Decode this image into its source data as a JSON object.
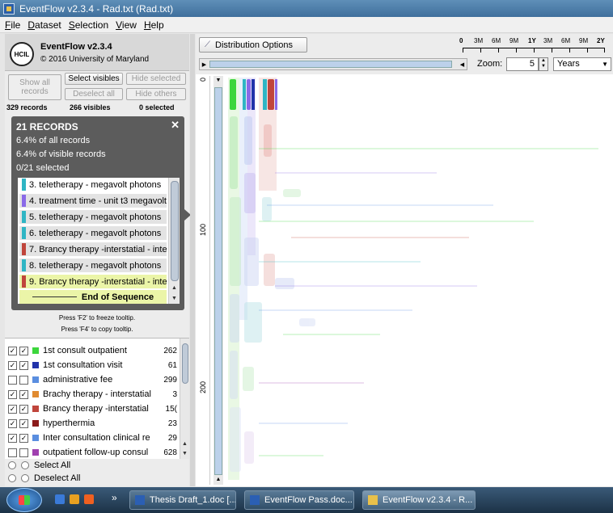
{
  "window": {
    "title": "EventFlow v2.3.4 - Rad.txt (Rad.txt)"
  },
  "menu": [
    "File",
    "Dataset",
    "Selection",
    "View",
    "Help"
  ],
  "brand": {
    "logo": "HCIL",
    "name": "EventFlow v2.3.4",
    "copyright": "© 2016 University of Maryland"
  },
  "buttons": {
    "show_all": "Show all records",
    "select_visibles": "Select visibles",
    "hide_selected": "Hide selected",
    "deselect_all": "Deselect all",
    "hide_others": "Hide others"
  },
  "counts": {
    "records": "329 records",
    "visibles": "266 visibles",
    "selected": "0 selected"
  },
  "tooltip": {
    "heading": "21 RECORDS",
    "line1": "6.4% of all records",
    "line2": "6.4% of visible records",
    "line3": "0/21 selected",
    "close": "✕",
    "items": [
      {
        "label": "3. teletherapy - megavolt photons",
        "color": "#2fb5c4"
      },
      {
        "label": "4. treatment time - unit t3 megavolt",
        "color": "#8a6ae8"
      },
      {
        "label": "5. teletherapy - megavolt photons",
        "color": "#2fb5c4"
      },
      {
        "label": "6. teletherapy - megavolt photons",
        "color": "#2fb5c4"
      },
      {
        "label": "7. Brancy therapy -interstatial - inte",
        "color": "#c0453c"
      },
      {
        "label": "8. teletherapy - megavolt photons",
        "color": "#2fb5c4"
      },
      {
        "label": "9. Brancy therapy -interstatial - inte",
        "color": "#c0453c"
      }
    ],
    "end": "End of Sequence"
  },
  "hints": {
    "freeze": "Press 'F2' to freeze tooltip.",
    "copy": "Press 'F4' to copy tooltip."
  },
  "legend": [
    {
      "name": "1st consult outpatient",
      "count": "262",
      "color": "#3dd63d",
      "checked": true
    },
    {
      "name": "1st consultation visit",
      "count": "61",
      "color": "#2233aa",
      "checked": true
    },
    {
      "name": "administrative fee",
      "count": "299",
      "color": "#5a8ee0",
      "checked": false
    },
    {
      "name": "Brachy therapy - interstatial",
      "count": "3",
      "color": "#e08a30",
      "checked": true
    },
    {
      "name": "Brancy therapy -interstatial",
      "count": "15(",
      "color": "#c0453c",
      "checked": true
    },
    {
      "name": "hyperthermia",
      "count": "23",
      "color": "#8b1a1a",
      "checked": true
    },
    {
      "name": "Inter consultation clinical re",
      "count": "29",
      "color": "#5a8ee0",
      "checked": true
    },
    {
      "name": "outpatient follow-up consul",
      "count": "628",
      "color": "#a040b0",
      "checked": false
    }
  ],
  "select": {
    "all": "Select All",
    "none": "Deselect All"
  },
  "toolbar": {
    "distribution": "Distribution Options",
    "ruler": [
      "0",
      "3M",
      "6M",
      "9M",
      "1Y",
      "3M",
      "6M",
      "9M",
      "2Y"
    ],
    "zoom_label": "Zoom:",
    "zoom_value": "5",
    "unit": "Years"
  },
  "y_ruler": [
    "0",
    "100",
    "200"
  ],
  "taskbar": [
    {
      "label": "Thesis Draft_1.doc [...",
      "kind": "word"
    },
    {
      "label": "EventFlow Pass.doc...",
      "kind": "word"
    },
    {
      "label": "EventFlow v2.3.4 - R...",
      "kind": "app"
    }
  ],
  "colors": {
    "green": "#3dd63d",
    "cyan": "#2fb5c4",
    "purple": "#8a6ae8",
    "red": "#c0453c",
    "blue": "#5a8ee0"
  }
}
